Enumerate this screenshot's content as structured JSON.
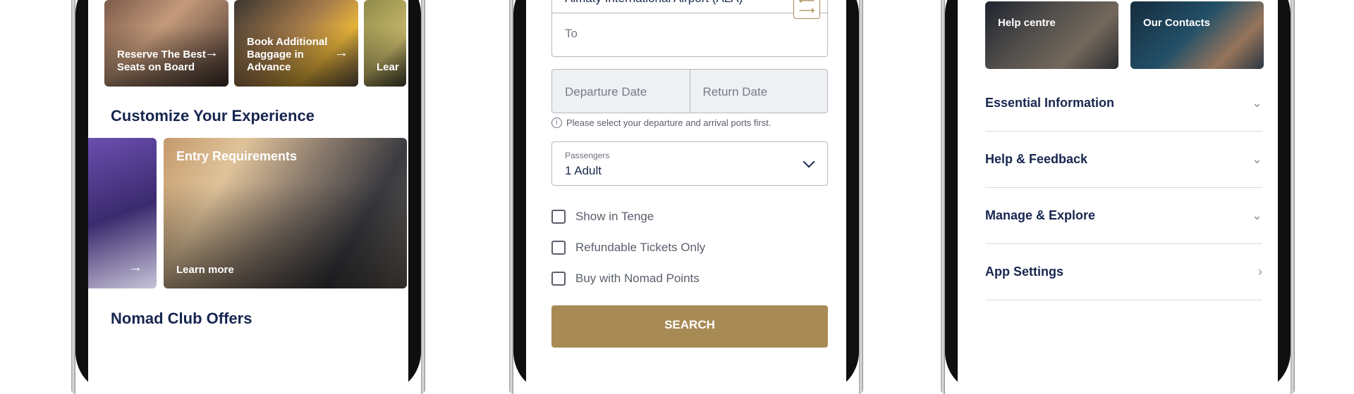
{
  "home": {
    "promo_cards": [
      {
        "label": "Reserve The Best Seats on Board"
      },
      {
        "label": "Book Additional Baggage in Advance"
      },
      {
        "label": "Lear"
      }
    ],
    "customize_title": "Customize Your Experience",
    "experience_cards": [
      {
        "title": "Entry Requirements",
        "cta": "Learn more"
      }
    ],
    "nomad_title": "Nomad Club Offers"
  },
  "booking": {
    "from_value": "Almaty International Airport (ALA)",
    "to_placeholder": "To",
    "departure_placeholder": "Departure Date",
    "return_placeholder": "Return Date",
    "dates_hint": "Please select your departure and arrival ports first.",
    "passengers_label": "Passengers",
    "passengers_value": "1 Adult",
    "checkboxes": [
      {
        "label": "Show in Tenge"
      },
      {
        "label": "Refundable Tickets Only"
      },
      {
        "label": "Buy with Nomad Points"
      }
    ],
    "search_label": "SEARCH"
  },
  "support": {
    "tiles": [
      {
        "label": "Help centre"
      },
      {
        "label": "Our Contacts"
      }
    ],
    "sections": [
      {
        "label": "Essential Information",
        "chevron": "chevron-down-icon"
      },
      {
        "label": "Help & Feedback",
        "chevron": "chevron-down-icon"
      },
      {
        "label": "Manage & Explore",
        "chevron": "chevron-down-icon"
      },
      {
        "label": "App Settings",
        "chevron": "chevron-right-icon"
      }
    ]
  },
  "colors": {
    "navy": "#17264f",
    "gold": "#a88a55",
    "field_border": "#b5b8bf"
  }
}
